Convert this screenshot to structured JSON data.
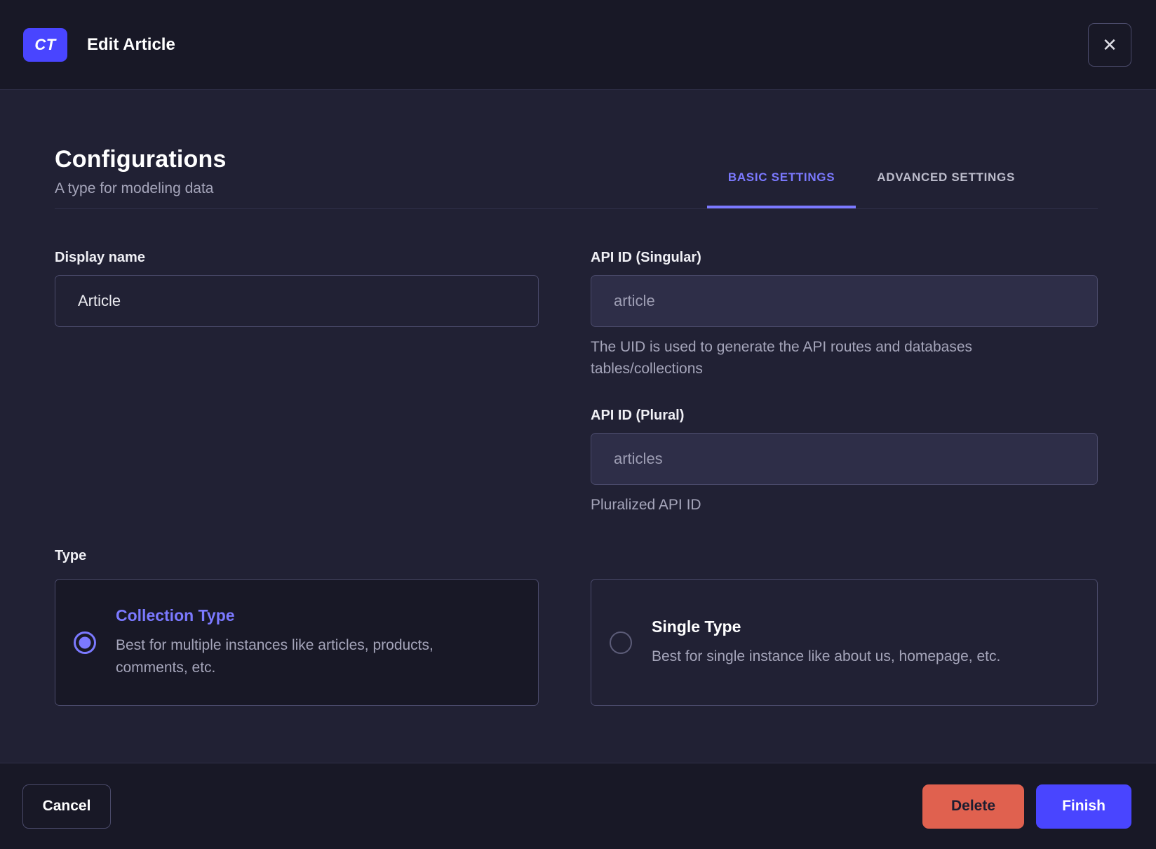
{
  "header": {
    "badge": "CT",
    "title": "Edit Article",
    "close_icon": "✕"
  },
  "content": {
    "title": "Configurations",
    "subtitle": "A type for modeling data",
    "tabs": [
      {
        "label": "BASIC SETTINGS",
        "active": true
      },
      {
        "label": "ADVANCED SETTINGS",
        "active": false
      }
    ],
    "fields": {
      "display_name": {
        "label": "Display name",
        "value": "Article"
      },
      "api_id_singular": {
        "label": "API ID (Singular)",
        "value": "article",
        "hint": "The UID is used to generate the API routes and databases tables/collections"
      },
      "api_id_plural": {
        "label": "API ID (Plural)",
        "value": "articles",
        "hint": "Pluralized API ID"
      }
    },
    "type": {
      "label": "Type",
      "options": [
        {
          "title": "Collection Type",
          "description": "Best for multiple instances like articles, products, comments, etc.",
          "selected": true
        },
        {
          "title": "Single Type",
          "description": "Best for single instance like about us, homepage, etc.",
          "selected": false
        }
      ]
    }
  },
  "footer": {
    "cancel_label": "Cancel",
    "delete_label": "Delete",
    "finish_label": "Finish"
  },
  "colors": {
    "accent": "#4945ff",
    "accent_light": "#7b79ff",
    "danger": "#e0614f",
    "background": "#212134",
    "surface": "#181826",
    "border": "#4a4a6a",
    "text_muted": "#a5a5ba"
  }
}
